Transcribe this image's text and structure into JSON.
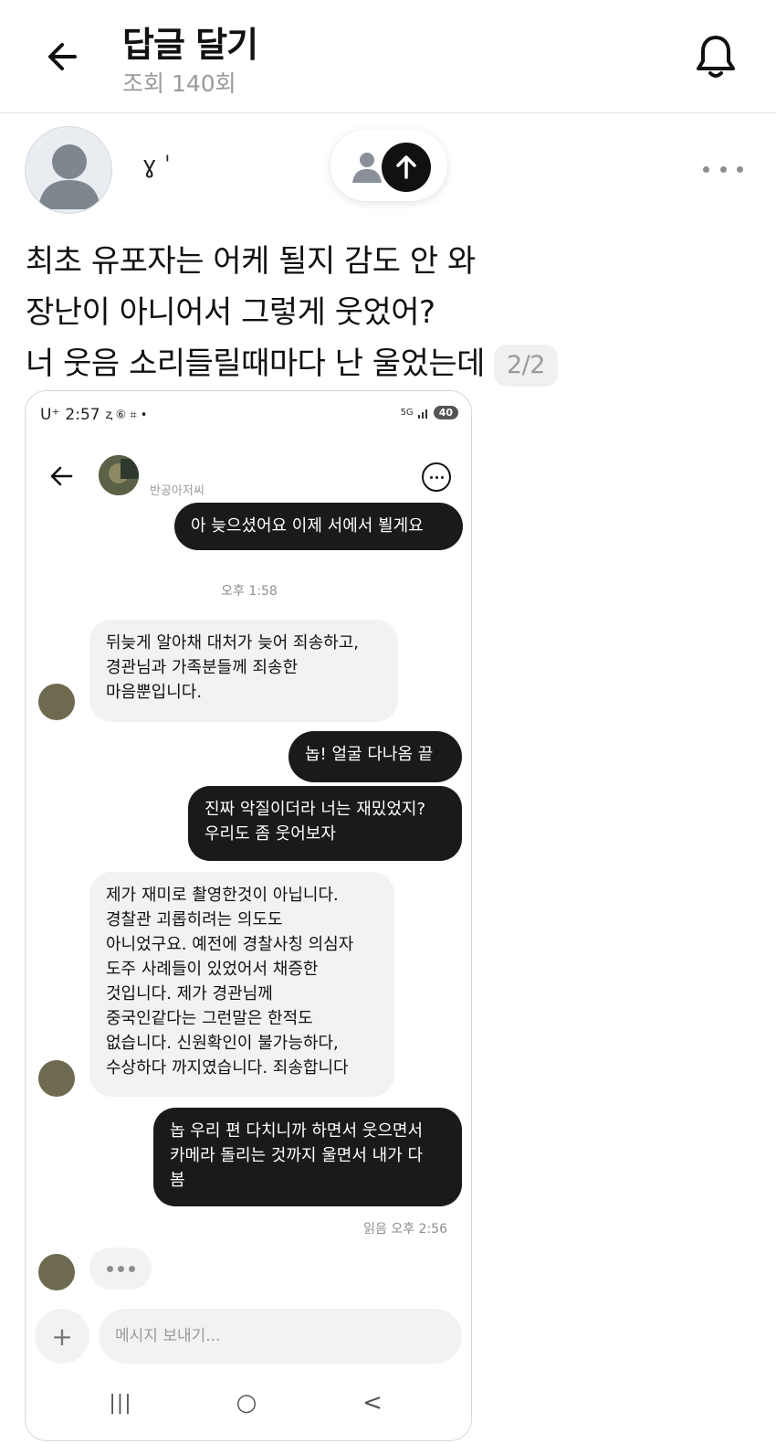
{
  "header": {
    "title": "답글 달기",
    "subtitle": "조회 140회",
    "back_icon": "arrow-left-icon",
    "bell_icon": "bell-icon"
  },
  "post": {
    "author_name": "ɣ   ˈ",
    "follow_icon": "arrow-up-icon",
    "more_icon": "more-horizontal-icon",
    "lines": [
      "최초 유포자는 어케 될지 감도 안 와",
      "장난이 아니어서 그렇게 웃었어?",
      "너 웃음 소리들릴때마다 난 울었는데"
    ],
    "page_badge": "2/2"
  },
  "screenshot": {
    "status_bar": {
      "carrier": "U⁺",
      "time": "2:57",
      "icons": "ⱬ ⑥ ⌗ •",
      "network": "5G",
      "battery": "40"
    },
    "chat_header": {
      "name": "반공아저씨"
    },
    "messages": [
      {
        "from": "me",
        "text": "아 늦으셨어요 이제 서에서 뵐게요"
      },
      {
        "from": "them",
        "text": "뒤늦게 알아채 대처가 늦어 죄송하고,\n경관님과 가족분들께 죄송한\n마음뿐입니다."
      },
      {
        "from": "me",
        "text": "놉!  얼굴 다나옴 끝"
      },
      {
        "from": "me",
        "text": "진짜 악질이더라 너는 재밌었지?\n우리도 좀 웃어보자"
      },
      {
        "from": "them",
        "text": "제가 재미로 촬영한것이 아닙니다.\n경찰관 괴롭히려는 의도도\n아니었구요. 예전에 경찰사칭 의심자\n도주 사례들이 있었어서 채증한\n것입니다. 제가 경관님께\n중국인같다는 그런말은 한적도\n없습니다. 신원확인이 불가능하다,\n수상하다 까지였습니다. 죄송합니다"
      },
      {
        "from": "me",
        "text": "놉 우리 편 다치니까 하면서 웃으면서\n카메라 돌리는 것까지 울면서 내가 다\n봄"
      }
    ],
    "timestamp": "오후 1:58",
    "read_receipt": "읽음 오후 2:56",
    "input_placeholder": "메시지 보내기...",
    "plus_label": "+",
    "nav": {
      "recent": "|||",
      "home": "○",
      "back": "<"
    }
  },
  "colors": {
    "my_bubble": "#1a1a1a",
    "their_bubble": "#f2f2f2",
    "muted_text": "#9a9a9a"
  }
}
